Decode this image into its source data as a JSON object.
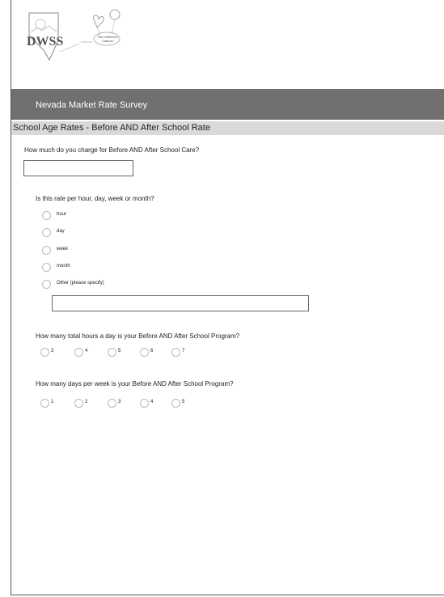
{
  "header": {
    "logo_text": "DWSS",
    "partner_logo_text": "The Children's Cabinet"
  },
  "survey": {
    "title": "Nevada Market Rate Survey",
    "section": "School Age Rates - Before AND After School Rate"
  },
  "q1": {
    "label": "How much do you charge for Before AND After School Care?",
    "value": ""
  },
  "q2": {
    "label": "Is this rate per hour, day, week or month?",
    "options": [
      "hour",
      "day",
      "week",
      "month",
      "Other (please specify)"
    ],
    "other_value": ""
  },
  "q3": {
    "label": "How many total hours a day is your Before AND After School Program?",
    "options": [
      "3",
      "4",
      "5",
      "6",
      "7"
    ]
  },
  "q4": {
    "label": "How many days per week is your Before AND After School Program?",
    "options": [
      "1",
      "2",
      "3",
      "4",
      "5"
    ]
  }
}
